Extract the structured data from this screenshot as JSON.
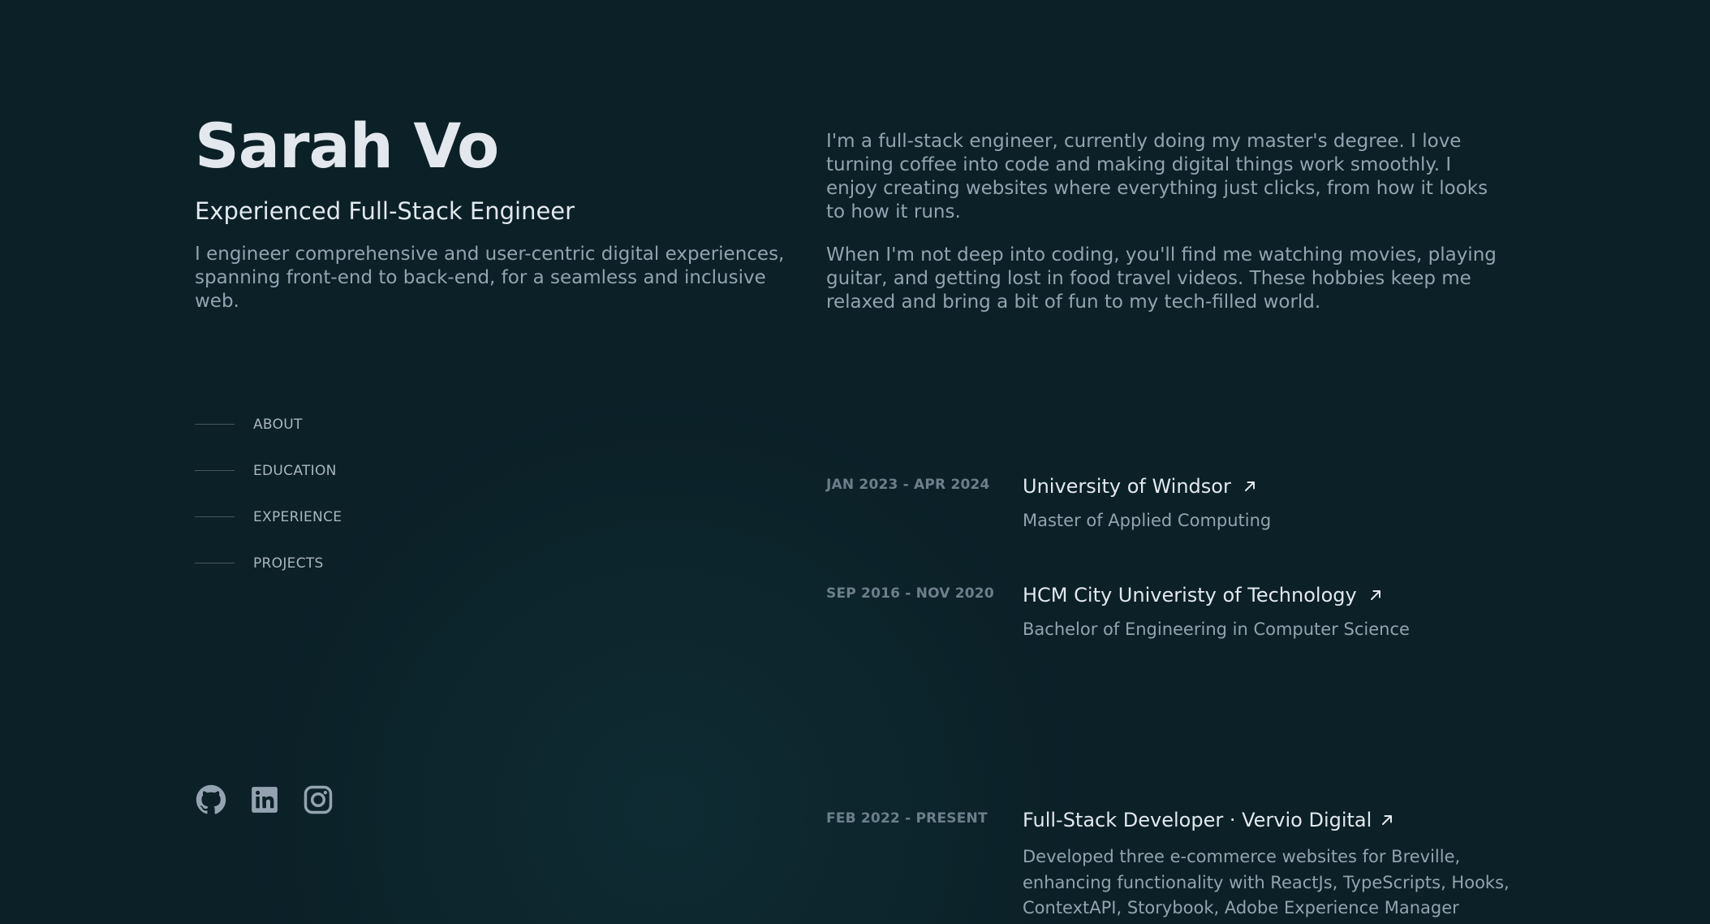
{
  "header": {
    "name": "Sarah Vo",
    "role": "Experienced Full-Stack Engineer",
    "tagline": "I engineer comprehensive and user-centric digital experiences, spanning front-end to back-end, for a seamless and inclusive web."
  },
  "nav": {
    "items": [
      {
        "label": "ABOUT"
      },
      {
        "label": "EDUCATION"
      },
      {
        "label": "EXPERIENCE"
      },
      {
        "label": "PROJECTS"
      }
    ]
  },
  "social": {
    "icons": [
      "github-icon",
      "linkedin-icon",
      "instagram-icon"
    ]
  },
  "about": {
    "p1": "I'm a full-stack engineer, currently doing my master's degree. I love turning coffee into code and making digital things work smoothly. I enjoy creating websites where everything just clicks, from how it looks to how it runs.",
    "p2": "When I'm not deep into coding, you'll find me watching movies, playing guitar, and getting lost in food travel videos. These hobbies keep me relaxed and bring a bit of fun to my tech-filled world."
  },
  "education": [
    {
      "date": "JAN 2023 - APR 2024",
      "title": "University of Windsor",
      "subtitle": "Master of Applied Computing"
    },
    {
      "date": "SEP 2016 - NOV 2020",
      "title": "HCM City Univeristy of Technology",
      "subtitle": "Bachelor of Engineering in Computer Science"
    }
  ],
  "experience": [
    {
      "date": "FEB 2022 - PRESENT",
      "title": "Full-Stack Developer · Vervio Digital",
      "description": "Developed three e-commerce websites for Breville, enhancing functionality with ReactJs, TypeScripts, Hooks, ContextAPI, Storybook, Adobe Experience Manager"
    }
  ],
  "colors": {
    "background": "#0b2027",
    "heading": "#e2e8ee",
    "body_text": "#91a4b0",
    "muted": "#6c7f8b"
  }
}
